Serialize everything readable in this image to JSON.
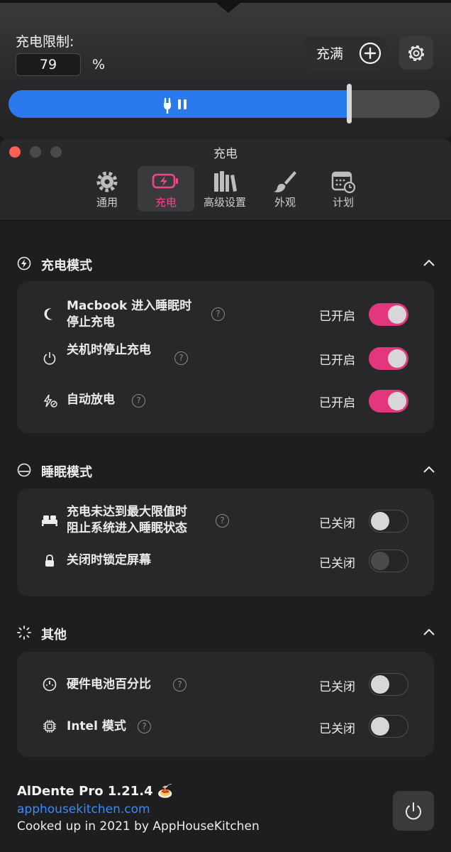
{
  "popover": {
    "limit_label": "充电限制:",
    "limit_value": "79",
    "limit_unit": "%",
    "full_charge_label": "充满",
    "charge_limit_percent": 79
  },
  "window": {
    "title": "充电",
    "tabs": [
      {
        "label": "通用",
        "icon": "gear-icon",
        "active": false
      },
      {
        "label": "充电",
        "icon": "battery-charging-icon",
        "active": true
      },
      {
        "label": "高级设置",
        "icon": "books-icon",
        "active": false
      },
      {
        "label": "外观",
        "icon": "paintbrush-icon",
        "active": false
      },
      {
        "label": "计划",
        "icon": "calendar-clock-icon",
        "active": false
      }
    ]
  },
  "sections": {
    "charging": {
      "title": "充电模式",
      "rows": [
        {
          "label_line1": "Macbook 进入睡眠时",
          "label_line2": "停止充电",
          "status": "已开启",
          "state": "on"
        },
        {
          "label_line1": "关机时停止充电",
          "status": "已开启",
          "state": "on"
        },
        {
          "label_line1": "自动放电",
          "status": "已开启",
          "state": "on"
        }
      ]
    },
    "sleep": {
      "title": "睡眠模式",
      "rows": [
        {
          "label_line1": "充电未达到最大限值时",
          "label_line2": "阻止系统进入睡眠状态",
          "status": "已关闭",
          "state": "off"
        },
        {
          "label_line1": "关闭时锁定屏幕",
          "status": "已关闭",
          "state": "off-disabled"
        }
      ]
    },
    "other": {
      "title": "其他",
      "rows": [
        {
          "label_line1": "硬件电池百分比",
          "status": "已关闭",
          "state": "off"
        },
        {
          "label_line1": "Intel 模式",
          "status": "已关闭",
          "state": "off"
        }
      ]
    }
  },
  "footer": {
    "app_name": "AlDente Pro 1.21.4 🍝",
    "link": "apphousekitchen.com",
    "credit": "Cooked up in 2021 by AppHouseKitchen"
  },
  "colors": {
    "accent_blue": "#2a7aee",
    "toggle_on": "#e4367d",
    "active_tab_text": "#f0458f",
    "close_red": "#ff5f57"
  }
}
